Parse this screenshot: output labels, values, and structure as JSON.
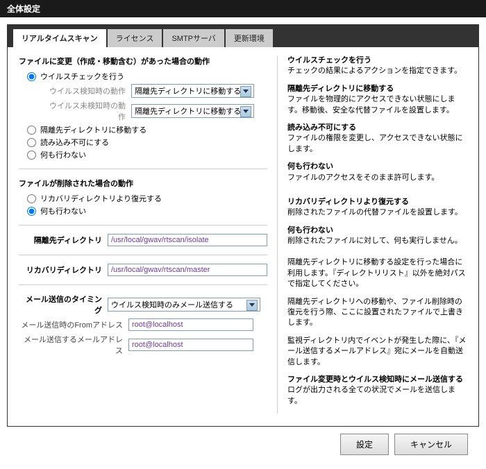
{
  "title": "全体設定",
  "tabs": [
    "リアルタイムスキャン",
    "ライセンス",
    "SMTPサーバ",
    "更新環境"
  ],
  "left": {
    "section1_title": "ファイルに変更（作成・移動含む）があった場合の動作",
    "r1": "ウイルスチェックを行う",
    "sub1_label": "ウイルス検知時の動作",
    "sub1_value": "隔離先ディレクトリに移動する",
    "sub2_label": "ウイルス未検知時の動作",
    "sub2_value": "隔離先ディレクトリに移動する",
    "r2": "隔離先ディレクトリに移動する",
    "r3": "読み込み不可にする",
    "r4": "何も行わない",
    "section2_title": "ファイルが削除された場合の動作",
    "r5": "リカバリディレクトリより復元する",
    "r6": "何も行わない",
    "dir1_label": "隔離先ディレクトリ",
    "dir1_value": "/usr/local/gwav/rtscan/isolate",
    "dir2_label": "リカバリディレクトリ",
    "dir2_value": "/usr/local/gwav/rtscan/master",
    "mail_timing_label": "メール送信のタイミング",
    "mail_timing_value": "ウイルス検知時のみメール送信する",
    "from_label": "メール送信時のFromアドレス",
    "from_value": "root@localhost",
    "to_label": "メール送信するメールアドレス",
    "to_value": "root@localhost"
  },
  "right": {
    "b1h": "ウイルスチェックを行う",
    "b1t": "チェックの結果によるアクションを指定できます。",
    "b2h": "隔離先ディレクトリに移動する",
    "b2t": "ファイルを物理的にアクセスできない状態にします。移動後、安全な代替ファイルを設置します。",
    "b3h": "読み込み不可にする",
    "b3t": "ファイルの権限を変更し、アクセスできない状態にします。",
    "b4h": "何も行わない",
    "b4t": "ファイルのアクセスをそのまま許可します。",
    "b5h": "リカバリディレクトリより復元する",
    "b5t": "削除されたファイルの代替ファイルを設置します。",
    "b6h": "何も行わない",
    "b6t": "削除されたファイルに対して、何も実行しません。",
    "b7t": "隔離先ディレクトリに移動する設定を行った場合に利用します。『ディレクトリリスト』以外を絶対パスで指定してください。",
    "b8t": "隔離先ディレクトリへの移動や、ファイル削除時の復元を行う際、ここに設置されたファイルで上書きします。",
    "b9t": "監視ディレクトリ内でイベントが発生した際に、『メール送信するメールアドレス』宛にメールを自動送信します。",
    "b10h": "ファイル変更時とウイルス検知時にメール送信する",
    "b10t": "ログが出力される全ての状況でメールを送信します。"
  },
  "buttons": {
    "ok": "設定",
    "cancel": "キャンセル"
  }
}
